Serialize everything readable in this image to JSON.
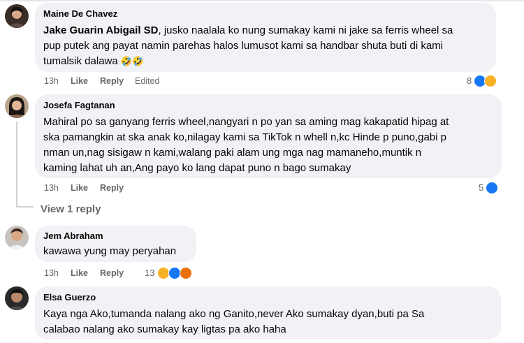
{
  "comments": [
    {
      "author": "Maine De Chavez",
      "mention": "Jake Guarin Abigail SD",
      "line1_rest": ", jusko naalala ko nung sumakay kami ni jake sa ferris wheel sa",
      "line2": "pup putek ang payat namin parehas halos lumusot kami sa handbar shuta buti di kami",
      "line3": "tumalsik dalawa",
      "emoji": "🤣🤣",
      "time": "13h",
      "like": "Like",
      "reply": "Reply",
      "edited": "Edited",
      "reaction_count": "8",
      "reactions": [
        "like",
        "haha"
      ]
    },
    {
      "author": "Josefa Fagtanan",
      "lines": [
        "Mahiral po sa ganyang ferris wheel,nangyari n po yan sa aming mag kakapatid hipag at",
        "ska pamangkin at ska anak ko,nilagay kami sa TikTok n whell n,kc Hinde p puno,gabi p",
        "nman un,nag sisigaw n kami,walang paki alam ung mga nag mamaneho,muntik n",
        "kaming lahat uh an,Ang payo ko lang dapat puno n bago sumakay"
      ],
      "time": "13h",
      "like": "Like",
      "reply": "Reply",
      "reaction_count": "5",
      "reactions": [
        "like"
      ],
      "view_replies": "View 1 reply"
    },
    {
      "author": "Jem Abraham",
      "lines": [
        "kawawa yung may peryahan"
      ],
      "time": "13h",
      "like": "Like",
      "reply": "Reply",
      "reaction_count": "13",
      "reactions": [
        "haha",
        "like",
        "angry"
      ]
    },
    {
      "author": "Elsa Guerzo",
      "lines": [
        "Kaya nga Ako,tumanda nalang ako ng Ganito,never Ako sumakay dyan,buti pa Sa",
        "calabao nalang ako sumakay kay ligtas pa ako haha"
      ]
    }
  ],
  "colors": {
    "like": "#1877f2",
    "haha": "#f7b125",
    "angry": "#e9710f",
    "bubble": "#f0f2f5",
    "meta": "#65676b"
  }
}
